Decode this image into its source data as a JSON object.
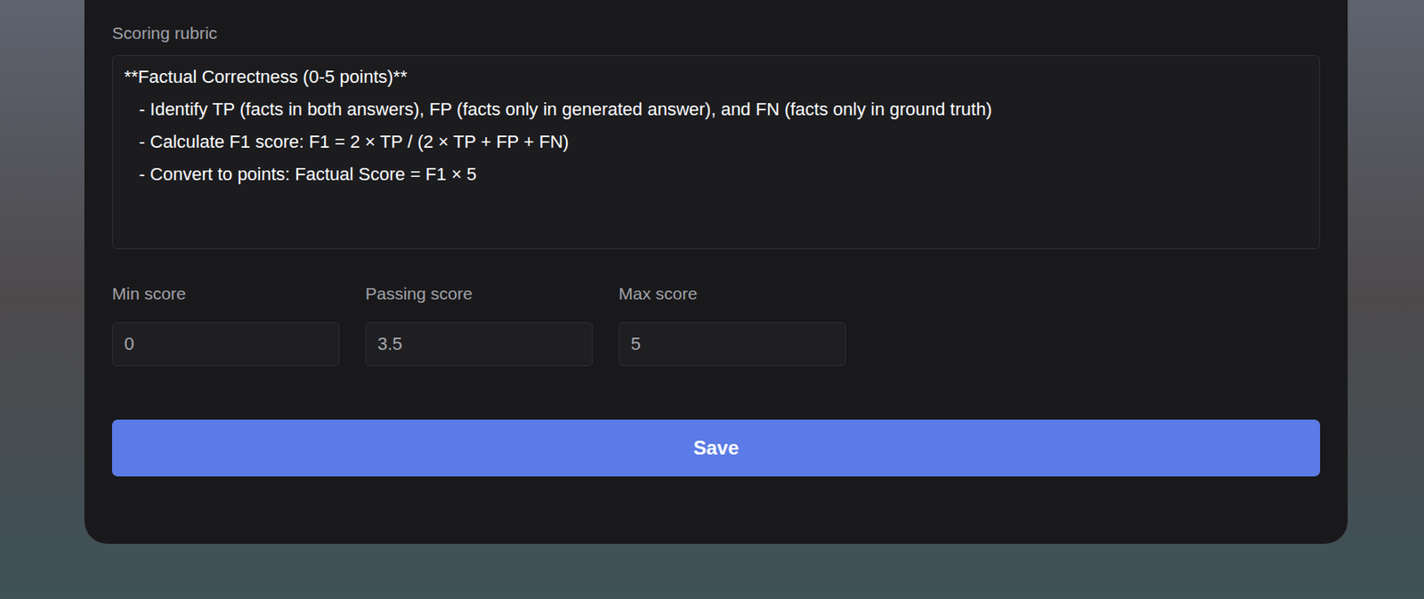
{
  "form": {
    "rubric": {
      "label": "Scoring rubric",
      "value": "**Factual Correctness (0-5 points)**\n   - Identify TP (facts in both answers), FP (facts only in generated answer), and FN (facts only in ground truth)\n   - Calculate F1 score: F1 = 2 × TP / (2 × TP + FP + FN)\n   - Convert to points: Factual Score = F1 × 5"
    },
    "fields": [
      {
        "label": "Min score",
        "value": "0"
      },
      {
        "label": "Passing score",
        "value": "3.5"
      },
      {
        "label": "Max score",
        "value": "5"
      }
    ],
    "save_button": "Save"
  }
}
